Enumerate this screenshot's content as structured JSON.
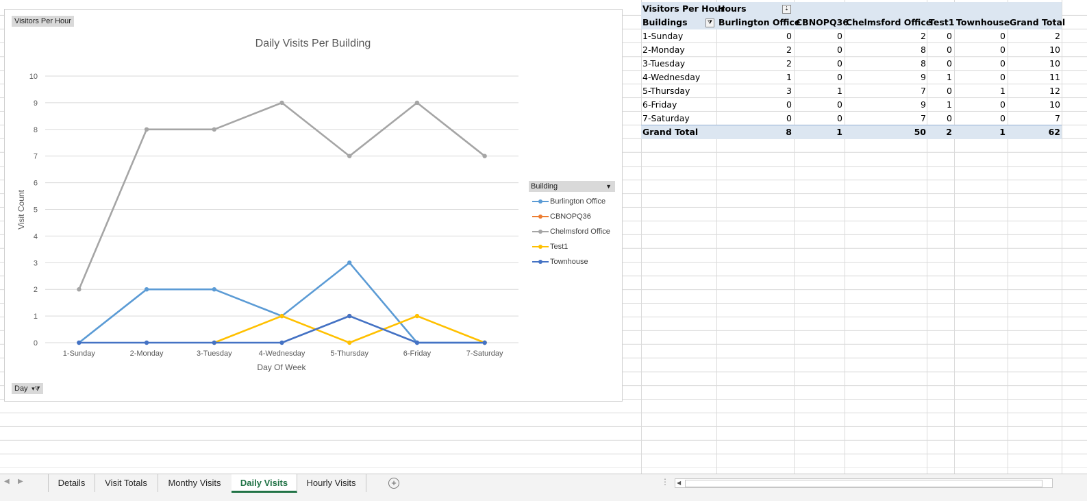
{
  "chart": {
    "field_button_top": "Visitors Per Hour",
    "field_button_bottom": "Day",
    "legend_title": "Building"
  },
  "chart_data": {
    "type": "line",
    "title": "Daily Visits Per Building",
    "xlabel": "Day Of Week",
    "ylabel": "Visit Count",
    "categories": [
      "1-Sunday",
      "2-Monday",
      "3-Tuesday",
      "4-Wednesday",
      "5-Thursday",
      "6-Friday",
      "7-Saturday"
    ],
    "ylim": [
      0,
      10
    ],
    "yticks": [
      0,
      1,
      2,
      3,
      4,
      5,
      6,
      7,
      8,
      9,
      10
    ],
    "grid": true,
    "legend_position": "right",
    "series": [
      {
        "name": "Burlington Office",
        "color": "#5b9bd5",
        "values": [
          0,
          2,
          2,
          1,
          3,
          0,
          0
        ]
      },
      {
        "name": "CBNOPQ36",
        "color": "#ed7d31",
        "values": [
          null,
          null,
          null,
          null,
          1,
          null,
          null
        ]
      },
      {
        "name": "Chelmsford Office",
        "color": "#a5a5a5",
        "values": [
          2,
          8,
          8,
          9,
          7,
          9,
          7
        ]
      },
      {
        "name": "Test1",
        "color": "#ffc000",
        "values": [
          null,
          null,
          0,
          1,
          0,
          1,
          0
        ]
      },
      {
        "name": "Townhouse",
        "color": "#4472c4",
        "values": [
          0,
          0,
          0,
          0,
          1,
          0,
          0
        ]
      }
    ]
  },
  "pivot": {
    "corner_label": "Visitors Per Hour",
    "col_field_label": "Hours",
    "row_field_label": "Buildings",
    "columns": [
      "Burlington Office",
      "CBNOPQ36",
      "Chelmsford Office",
      "Test1",
      "Townhouse",
      "Grand Total"
    ],
    "rows": [
      {
        "label": "1-Sunday",
        "values": [
          "0",
          "0",
          "2",
          "0",
          "0",
          "2"
        ]
      },
      {
        "label": "2-Monday",
        "values": [
          "2",
          "0",
          "8",
          "0",
          "0",
          "10"
        ]
      },
      {
        "label": "3-Tuesday",
        "values": [
          "2",
          "0",
          "8",
          "0",
          "0",
          "10"
        ]
      },
      {
        "label": "4-Wednesday",
        "values": [
          "1",
          "0",
          "9",
          "1",
          "0",
          "11"
        ]
      },
      {
        "label": "5-Thursday",
        "values": [
          "3",
          "1",
          "7",
          "0",
          "1",
          "12"
        ]
      },
      {
        "label": "6-Friday",
        "values": [
          "0",
          "0",
          "9",
          "1",
          "0",
          "10"
        ]
      },
      {
        "label": "7-Saturday",
        "values": [
          "0",
          "0",
          "7",
          "0",
          "0",
          "7"
        ]
      }
    ],
    "total_row": {
      "label": "Grand Total",
      "values": [
        "8",
        "1",
        "50",
        "2",
        "1",
        "62"
      ]
    }
  },
  "tabs": [
    "Details",
    "Visit Totals",
    "Monthy Visits",
    "Daily Visits",
    "Hourly Visits"
  ],
  "active_tab": "Daily Visits",
  "icons": {
    "add_sheet": "plus-circle-icon",
    "splitter": "vertical-dots-icon"
  }
}
